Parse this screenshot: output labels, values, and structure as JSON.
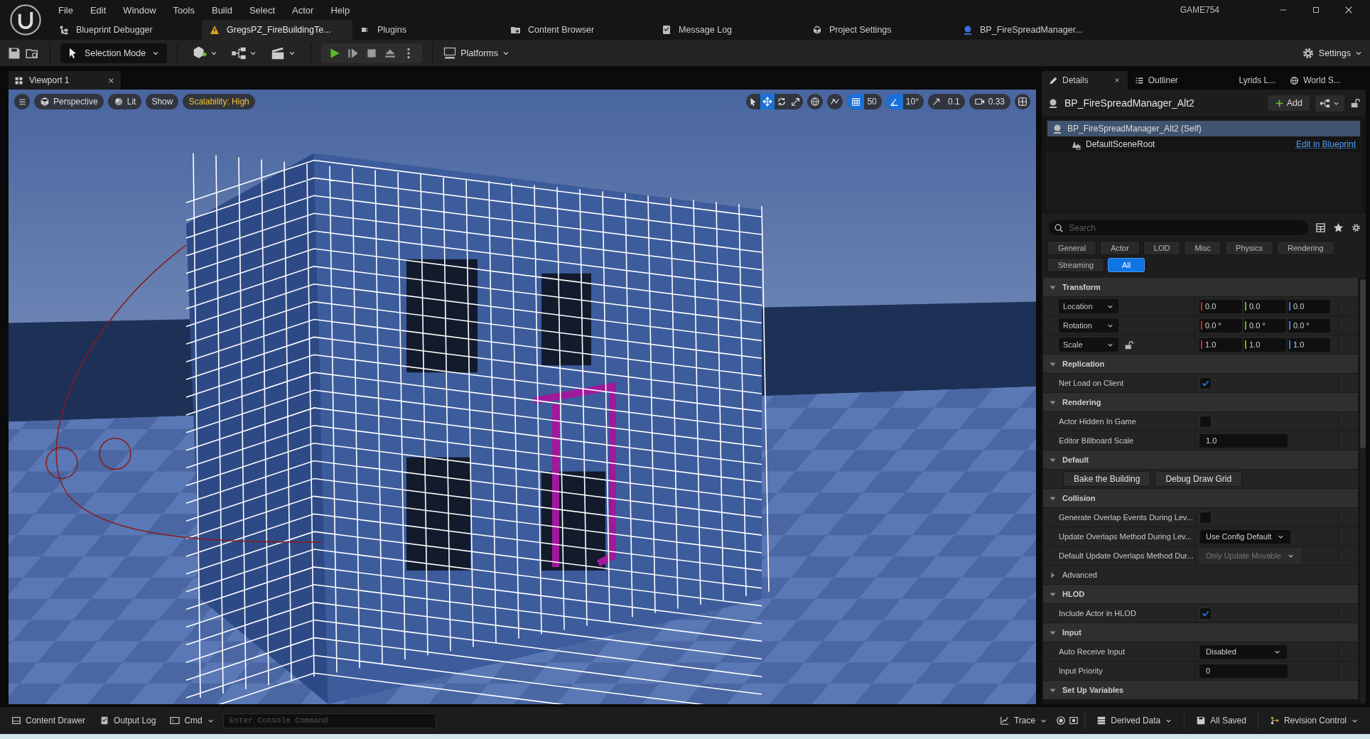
{
  "app": {
    "menus": [
      "File",
      "Edit",
      "Window",
      "Tools",
      "Build",
      "Select",
      "Actor",
      "Help"
    ],
    "project": "GAME754"
  },
  "doc_tabs": [
    {
      "label": "Blueprint Debugger",
      "kind": "debugger",
      "selected": false
    },
    {
      "label": "GregsPZ_FireBuildingTe...",
      "kind": "level",
      "selected": true
    },
    {
      "label": "Plugins",
      "kind": "plugin",
      "selected": false
    },
    {
      "label": "Content Browser",
      "kind": "browser",
      "selected": false
    },
    {
      "label": "Message Log",
      "kind": "log",
      "selected": false
    },
    {
      "label": "Project Settings",
      "kind": "settings",
      "selected": false
    },
    {
      "label": "BP_FireSpreadManager...",
      "kind": "actor",
      "selected": false
    }
  ],
  "toolbar": {
    "mode": "Selection Mode",
    "platforms": "Platforms",
    "settings": "Settings"
  },
  "viewport": {
    "tab": "Viewport 1",
    "view": "Perspective",
    "lit": "Lit",
    "show": "Show",
    "scalability": "Scalability: High",
    "transform_tools": [
      {
        "kind": "select",
        "selected": false
      },
      {
        "kind": "move",
        "selected": true
      },
      {
        "kind": "rotate",
        "selected": false
      },
      {
        "kind": "scale",
        "selected": false
      }
    ],
    "grid_snap": {
      "on": true,
      "value": "50"
    },
    "angle_snap": {
      "on": true,
      "value": "10°"
    },
    "scale_snap": {
      "on": false,
      "value": "0.1"
    },
    "camera_speed": "0.33"
  },
  "panel_tabs": [
    {
      "label": "Details",
      "kind": "details",
      "selected": true
    },
    {
      "label": "Outliner",
      "kind": "outliner",
      "selected": false
    },
    {
      "label": "Lyrids L...",
      "kind": "plain",
      "selected": false
    },
    {
      "label": "World S...",
      "kind": "world",
      "selected": false
    }
  ],
  "details": {
    "actor": "BP_FireSpreadManager_Alt2",
    "add": "Add",
    "components": [
      {
        "label": "BP_FireSpreadManager_Alt2 (Self)",
        "selected": true,
        "children": [
          {
            "label": "DefaultSceneRoot",
            "selected": false
          }
        ]
      }
    ],
    "edit_link": "Edit in Blueprint",
    "search": {
      "placeholder": "Search"
    },
    "filters": [
      {
        "label": "General",
        "selected": false
      },
      {
        "label": "Actor",
        "selected": false
      },
      {
        "label": "LOD",
        "selected": false
      },
      {
        "label": "Misc",
        "selected": false
      },
      {
        "label": "Physics",
        "selected": false
      },
      {
        "label": "Rendering",
        "selected": false
      },
      {
        "label": "Streaming",
        "selected": false
      },
      {
        "label": "All",
        "selected": true
      }
    ],
    "sections": [
      {
        "title": "Transform",
        "expanded": true,
        "rows": [
          {
            "kind": "vector",
            "label": "Location",
            "values": [
              "0.0",
              "0.0",
              "0.0"
            ]
          },
          {
            "kind": "vector",
            "label": "Rotation",
            "values": [
              "0.0 °",
              "0.0 °",
              "0.0 °"
            ]
          },
          {
            "kind": "vector",
            "label": "Scale",
            "ratio_locked": false,
            "values": [
              "1.0",
              "1.0",
              "1.0"
            ]
          }
        ]
      },
      {
        "title": "Replication",
        "expanded": true,
        "rows": [
          {
            "kind": "checkbox",
            "label": "Net Load on Client",
            "checked": true
          }
        ]
      },
      {
        "title": "Rendering",
        "expanded": true,
        "rows": [
          {
            "kind": "checkbox",
            "label": "Actor Hidden In Game",
            "checked": false
          },
          {
            "kind": "number",
            "label": "Editor Billboard Scale",
            "value": "1.0"
          }
        ]
      },
      {
        "title": "Default",
        "expanded": true,
        "rows": [
          {
            "kind": "buttons",
            "labels": [
              "Bake the Building",
              "Debug Draw Grid"
            ]
          }
        ]
      },
      {
        "title": "Collision",
        "expanded": true,
        "rows": [
          {
            "kind": "checkbox",
            "label": "Generate Overlap Events During Lev...",
            "checked": false
          },
          {
            "kind": "dropdown",
            "label": "Update Overlaps Method During Lev...",
            "value": "Use Config Default",
            "disabled": false
          },
          {
            "kind": "dropdown",
            "label": "Default Update Overlaps Method Dur...",
            "value": "Only Update Movable",
            "disabled": true
          },
          {
            "kind": "group",
            "label": "Advanced",
            "expanded": false
          }
        ]
      },
      {
        "title": "HLOD",
        "expanded": true,
        "rows": [
          {
            "kind": "checkbox",
            "label": "Include Actor in HLOD",
            "checked": true
          }
        ]
      },
      {
        "title": "Input",
        "expanded": true,
        "rows": [
          {
            "kind": "dropdown",
            "label": "Auto Receive Input",
            "value": "Disabled",
            "disabled": false
          },
          {
            "kind": "number",
            "label": "Input Priority",
            "value": "0"
          }
        ]
      },
      {
        "title": "Set Up Variables",
        "expanded": true
      }
    ]
  },
  "bottom_bar": {
    "left": [
      {
        "kind": "drawer",
        "label": "Content Drawer"
      },
      {
        "kind": "log",
        "label": "Output Log"
      }
    ],
    "cmd": "Cmd",
    "console_placeholder": "Enter Console Command",
    "trace": "Trace",
    "derived_data": "Derived Data",
    "saved": "All Saved",
    "revision": "Revision Control"
  }
}
